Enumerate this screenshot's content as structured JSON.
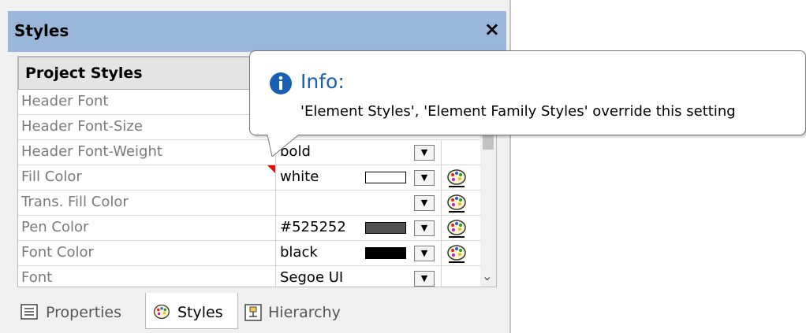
{
  "panel": {
    "title": "Styles",
    "close_label": "×"
  },
  "grid": {
    "header": "Project Styles",
    "rows": [
      {
        "name": "Header Font",
        "value": ""
      },
      {
        "name": "Header Font-Size",
        "value": ""
      },
      {
        "name": "Header Font-Weight",
        "value": "bold"
      },
      {
        "name": "Fill Color",
        "value": "white",
        "swatch": "#ffffff"
      },
      {
        "name": "Trans. Fill Color",
        "value": ""
      },
      {
        "name": "Pen Color",
        "value": "#525252",
        "swatch": "#525252"
      },
      {
        "name": "Font Color",
        "value": "black",
        "swatch": "#000000"
      },
      {
        "name": "Font",
        "value": "Segoe UI"
      }
    ]
  },
  "tooltip": {
    "heading": "Info:",
    "message": "'Element Styles', 'Element Family Styles' override this setting"
  },
  "tabs": [
    {
      "label": "Properties",
      "icon": "properties-icon"
    },
    {
      "label": "Styles",
      "icon": "palette-icon",
      "active": true
    },
    {
      "label": "Hierarchy",
      "icon": "hierarchy-icon"
    }
  ],
  "colors": {
    "title_bar": "#9ab6d8",
    "info_blue": "#1a5fb4",
    "modified_marker": "#e01010"
  }
}
